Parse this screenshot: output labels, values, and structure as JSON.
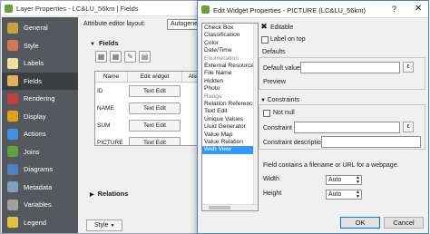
{
  "back_window": {
    "title": "Layer Properties - LC&LU_56km | Fields",
    "nav_items": [
      {
        "label": "General",
        "icon": "general-icon",
        "color": "#c8a040",
        "active": false
      },
      {
        "label": "Style",
        "icon": "style-icon",
        "color": "#d07850",
        "active": false
      },
      {
        "label": "Labels",
        "icon": "labels-icon",
        "color": "#f0e0a0",
        "active": false
      },
      {
        "label": "Fields",
        "icon": "fields-icon",
        "color": "#e0b060",
        "active": true
      },
      {
        "label": "Rendering",
        "icon": "rendering-icon",
        "color": "#c04040",
        "active": false
      },
      {
        "label": "Display",
        "icon": "display-icon",
        "color": "#e0a020",
        "active": false
      },
      {
        "label": "Actions",
        "icon": "actions-icon",
        "color": "#4090e0",
        "active": false
      },
      {
        "label": "Joins",
        "icon": "joins-icon",
        "color": "#60a040",
        "active": false
      },
      {
        "label": "Diagrams",
        "icon": "diagrams-icon",
        "color": "#5080c0",
        "active": false
      },
      {
        "label": "Metadata",
        "icon": "metadata-icon",
        "color": "#80a0c0",
        "active": false
      },
      {
        "label": "Variables",
        "icon": "variables-icon",
        "color": "#a0a0a0",
        "active": false
      },
      {
        "label": "Legend",
        "icon": "legend-icon",
        "color": "#e0c040",
        "active": false
      }
    ],
    "attr_layout_label": "Attribute editor layout:",
    "attr_layout_value": "Autogenerate",
    "fields_section": "Fields",
    "columns": [
      "Name",
      "Edit widget",
      "Alia"
    ],
    "rows": [
      {
        "name": "ID",
        "widget": "Text Edit"
      },
      {
        "name": "NAME",
        "widget": "Text Edit"
      },
      {
        "name": "SUM",
        "widget": "Text Edit"
      },
      {
        "name": "PICTURE",
        "widget": "Text Edit"
      }
    ],
    "relations_section": "Relations",
    "style_button": "Style"
  },
  "dialog": {
    "title": "Edit Widget Properties - PICTURE (LC&LU_56km)",
    "help": "?",
    "close": "✕",
    "widget_types": [
      {
        "label": "Check Box",
        "state": "normal"
      },
      {
        "label": "Classification",
        "state": "normal"
      },
      {
        "label": "Color",
        "state": "normal"
      },
      {
        "label": "Date/Time",
        "state": "normal"
      },
      {
        "label": "Enumeration",
        "state": "dim"
      },
      {
        "label": "External Resource",
        "state": "normal"
      },
      {
        "label": "File Name",
        "state": "normal"
      },
      {
        "label": "Hidden",
        "state": "normal"
      },
      {
        "label": "Photo",
        "state": "normal"
      },
      {
        "label": "Range",
        "state": "dim"
      },
      {
        "label": "Relation Reference",
        "state": "normal"
      },
      {
        "label": "Text Edit",
        "state": "normal"
      },
      {
        "label": "Unique Values",
        "state": "normal"
      },
      {
        "label": "Uuid Generator",
        "state": "normal"
      },
      {
        "label": "Value Map",
        "state": "normal"
      },
      {
        "label": "Value Relation",
        "state": "normal"
      },
      {
        "label": "Web View",
        "state": "selected"
      }
    ],
    "editable_label": "Editable",
    "editable_checked": true,
    "label_on_top": "Label on top",
    "label_on_top_checked": false,
    "defaults_group": "Defaults",
    "default_value_label": "Default value",
    "default_value": "",
    "preview_label": "Preview",
    "constraints_group": "Constraints",
    "not_null_label": "Not null",
    "not_null_checked": false,
    "constraint_label": "Constraint",
    "constraint_value": "",
    "constraint_desc_label": "Constraint description",
    "constraint_desc_value": "",
    "webview_info": "Field contains a filename or URL for a webpage.",
    "width_label": "Width",
    "width_value": "Auto",
    "height_label": "Height",
    "height_value": "Auto",
    "ok_button": "OK",
    "cancel_button": "Cancel"
  }
}
